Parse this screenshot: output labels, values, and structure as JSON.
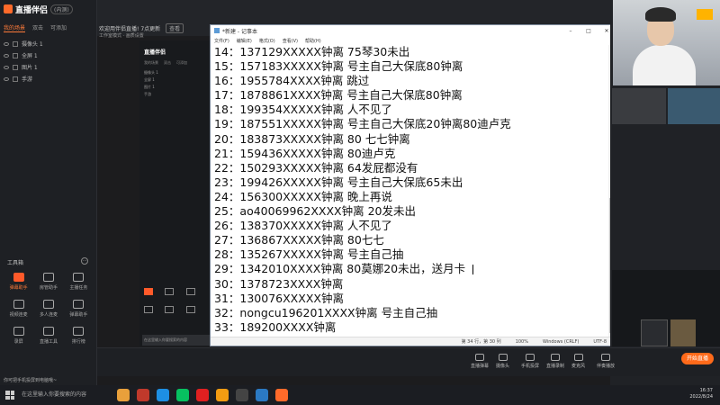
{
  "app": {
    "logo_text": "直播伴侣",
    "logo_badge": "(内测)",
    "scene_tabs": [
      "我的场景",
      "双击",
      "可添加"
    ],
    "scenes": [
      "摄像头 1",
      "全屏 1",
      "图片 1",
      "手游"
    ],
    "toolbox_title": "工具箱",
    "tools": [
      {
        "label": "弹幕助手",
        "accent": true
      },
      {
        "label": "房管助手",
        "accent": false
      },
      {
        "label": "主播任务",
        "accent": false
      },
      {
        "label": "视频连麦",
        "accent": false
      },
      {
        "label": "多人连麦",
        "accent": false
      },
      {
        "label": "弹幕助手",
        "accent": false
      },
      {
        "label": "录屏",
        "accent": false
      },
      {
        "label": "直播工具",
        "accent": false
      },
      {
        "label": "排行榜",
        "accent": false
      }
    ],
    "notice": "欢迎用伴侣直播! 7点更新",
    "notice_btn": "查看",
    "subbar": "工作室模式 · 画质设置"
  },
  "preview": {
    "logo": "直播伴侣",
    "tabs": [
      "我的场景",
      "双击",
      "可添加"
    ],
    "scenes": [
      "摄像头 1",
      "全屏 1",
      "图片 1",
      "手游"
    ],
    "taskbar_text": "在这里输入你要搜索的内容"
  },
  "notepad": {
    "title": "*新建 - 记事本",
    "menu": [
      "文件(F)",
      "编辑(E)",
      "格式(O)",
      "查看(V)",
      "帮助(H)"
    ],
    "controls": [
      "–",
      "□",
      "✕"
    ],
    "lines": [
      "14：137129XXXXX钟离 75琴30未出",
      "15：157183XXXXX钟离 号主自己大保底80钟离",
      "16：1955784XXXX钟离 跳过",
      "17：1878861XXXX钟离 号主自己大保底80钟离",
      "18：199354XXXXX钟离 人不见了",
      "19：187551XXXXX钟离 号主自己大保底20钟离80迪卢克",
      "20：183873XXXXX钟离 80 七七钟离",
      "21：159436XXXXX钟离 80迪卢克",
      "22：150293XXXXX钟离 64发屁都没有",
      "23：199426XXXXX钟离 号主自己大保底65未出",
      "24：156300XXXXX钟离 晚上再说",
      "25：ao40069962XXXX钟离 20发未出",
      "26：138370XXXXX钟离 人不见了",
      "27：136867XXXXX钟离 80七七",
      "28：135267XXXXX钟离 号主自己抽",
      "29：1342010XXXX钟离 80莫娜20未出，送月卡",
      "30：1378723XXXX钟离",
      "31：130076XXXXX钟离",
      "32：nongcu196201XXXX钟离 号主自己抽",
      "33：189200XXXX钟离"
    ],
    "status": {
      "position": "第 34 行，第 30 列",
      "zoom": "100%",
      "eol": "Windows (CRLF)",
      "encoding": "UTF-8"
    }
  },
  "bottombar": {
    "items": [
      "直播弹幕",
      "摄像头",
      "手机投屏",
      "直播录制",
      "麦克风",
      "伴奏播放"
    ],
    "live_button": "开始直播"
  },
  "notification": "你可把手机投屏到电脑哦~",
  "taskbar": {
    "search_placeholder": "在这里输入你要搜索的内容",
    "time": "16:37",
    "date": "2022/8/24"
  },
  "colors": {
    "accent": "#ff6a1a",
    "app_bg": "#1e2024",
    "notepad_bg": "#ffffff"
  }
}
